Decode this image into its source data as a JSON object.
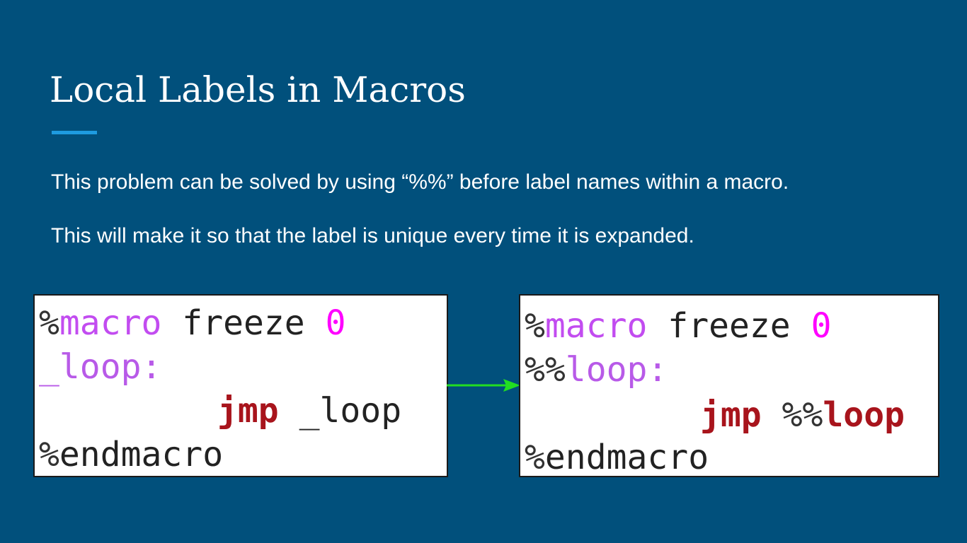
{
  "slide": {
    "title": "Local Labels in Macros",
    "paragraphs": [
      "This problem can be solved by using “%%” before label names within a macro.",
      "This will make it so that the label is unique every time it is expanded."
    ],
    "accent_color": "#1e9be0",
    "background_color": "#01507c"
  },
  "code_before": {
    "line1": {
      "pct": "%",
      "keyword": "macro",
      "rest": " freeze ",
      "number": "0"
    },
    "line2": {
      "label": "_loop:"
    },
    "line3": {
      "instr": "jmp",
      "space": " ",
      "operand": "_loop"
    },
    "line4": {
      "pct": "%",
      "rest": "endmacro"
    }
  },
  "code_after": {
    "line1": {
      "pct": "%",
      "keyword": "macro",
      "rest": " freeze ",
      "number": "0"
    },
    "line2": {
      "pct": "%%",
      "label": "loop:"
    },
    "line3": {
      "instr": "jmp",
      "space": " ",
      "pct": "%%",
      "operand": "loop"
    },
    "line4": {
      "pct": "%",
      "rest": "endmacro"
    }
  },
  "arrow": {
    "color": "#22dd22",
    "icon": "right-arrow-icon"
  }
}
